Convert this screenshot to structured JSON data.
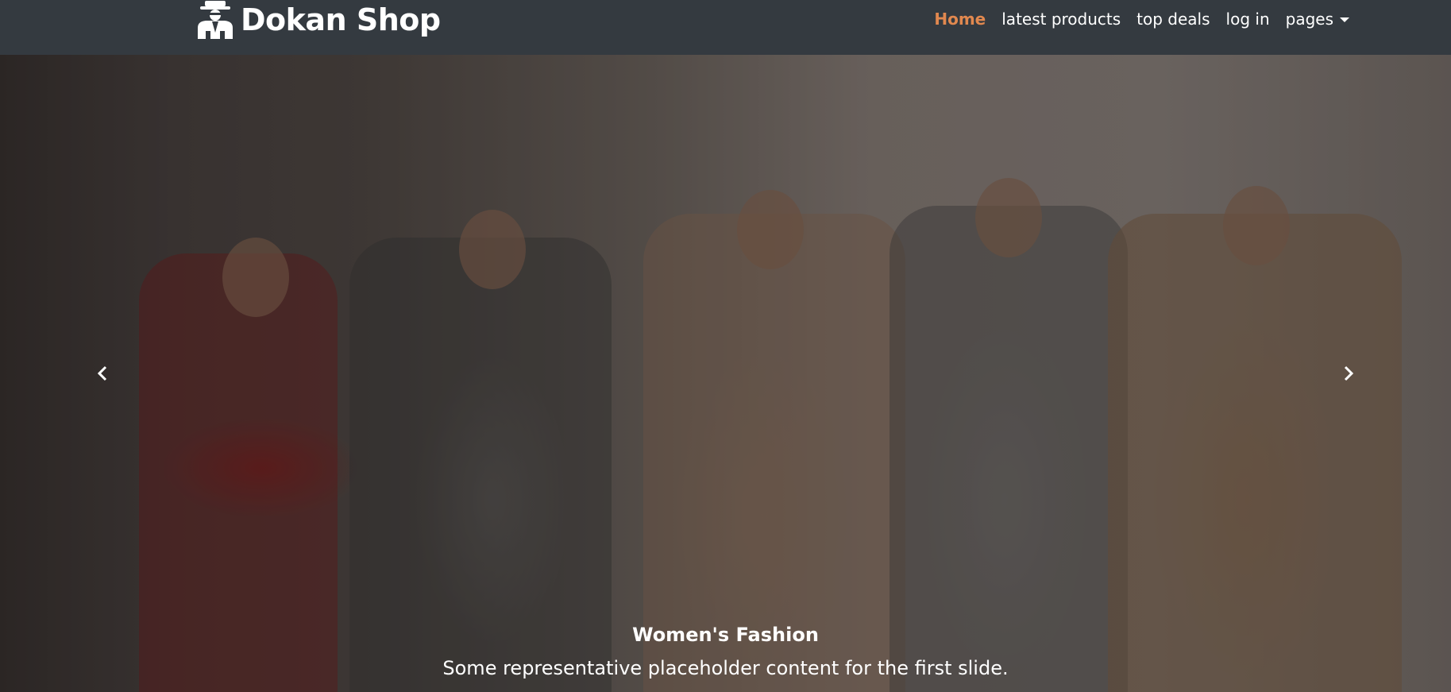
{
  "brand": {
    "name": "Dokan Shop",
    "icon": "shop-keeper-icon"
  },
  "nav": {
    "items": [
      {
        "label": "Home",
        "active": true
      },
      {
        "label": "latest products",
        "active": false
      },
      {
        "label": "top deals",
        "active": false
      },
      {
        "label": "log in",
        "active": false
      },
      {
        "label": "pages",
        "active": false,
        "dropdown": true
      }
    ]
  },
  "carousel": {
    "slide": {
      "title": "Women's Fashion",
      "text": "Some representative placeholder content for the first slide."
    },
    "controls": {
      "prev_icon": "chevron-left-icon",
      "next_icon": "chevron-right-icon"
    }
  },
  "colors": {
    "navbar_bg": "#343a40",
    "accent": "#e1884f",
    "text": "#ffffff"
  }
}
